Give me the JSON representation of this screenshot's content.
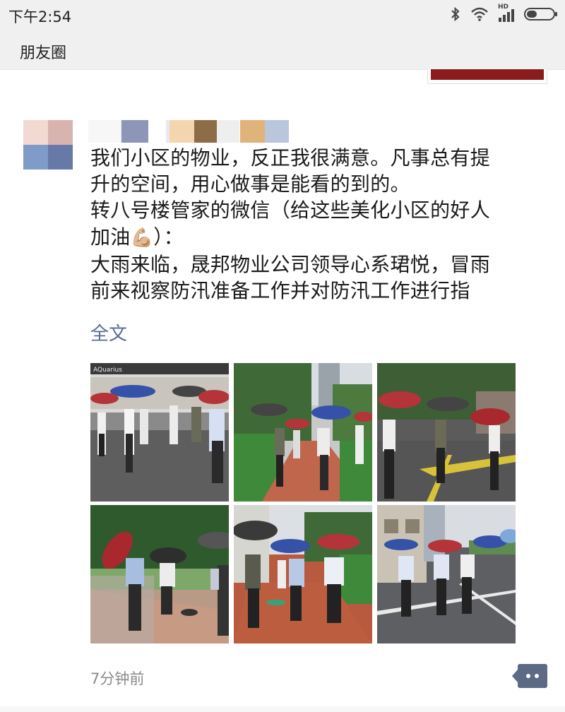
{
  "status_bar": {
    "time": "下午2:54",
    "network": "HD"
  },
  "header": {
    "title": "朋友圈"
  },
  "post": {
    "lines": [
      "我们小区的物业，反正我很满意。凡事总有提",
      "升的空间，用心做事是能看的到的。",
      "转八号楼管家的微信（给这些美化小区的好人",
      "加油",
      "）：",
      "大雨来临，晟邦物业公司领导心系珺悦，冒雨",
      "前来视察防汛准备工作并对防汛工作进行指"
    ],
    "emoji": "💪🏼",
    "full_text_label": "全文",
    "timestamp": "7分钟前"
  },
  "photos": [
    {
      "name": "photo-1",
      "caption": "AQuarius"
    },
    {
      "name": "photo-2"
    },
    {
      "name": "photo-3"
    },
    {
      "name": "photo-4"
    },
    {
      "name": "photo-5"
    },
    {
      "name": "photo-6"
    }
  ],
  "colors": {
    "link": "#576b95",
    "comment_button": "#5d6a86",
    "bar": "#f0f0f0"
  },
  "icons": [
    "bluetooth-icon",
    "wifi-icon",
    "signal-icon",
    "battery-icon",
    "comment-icon"
  ]
}
